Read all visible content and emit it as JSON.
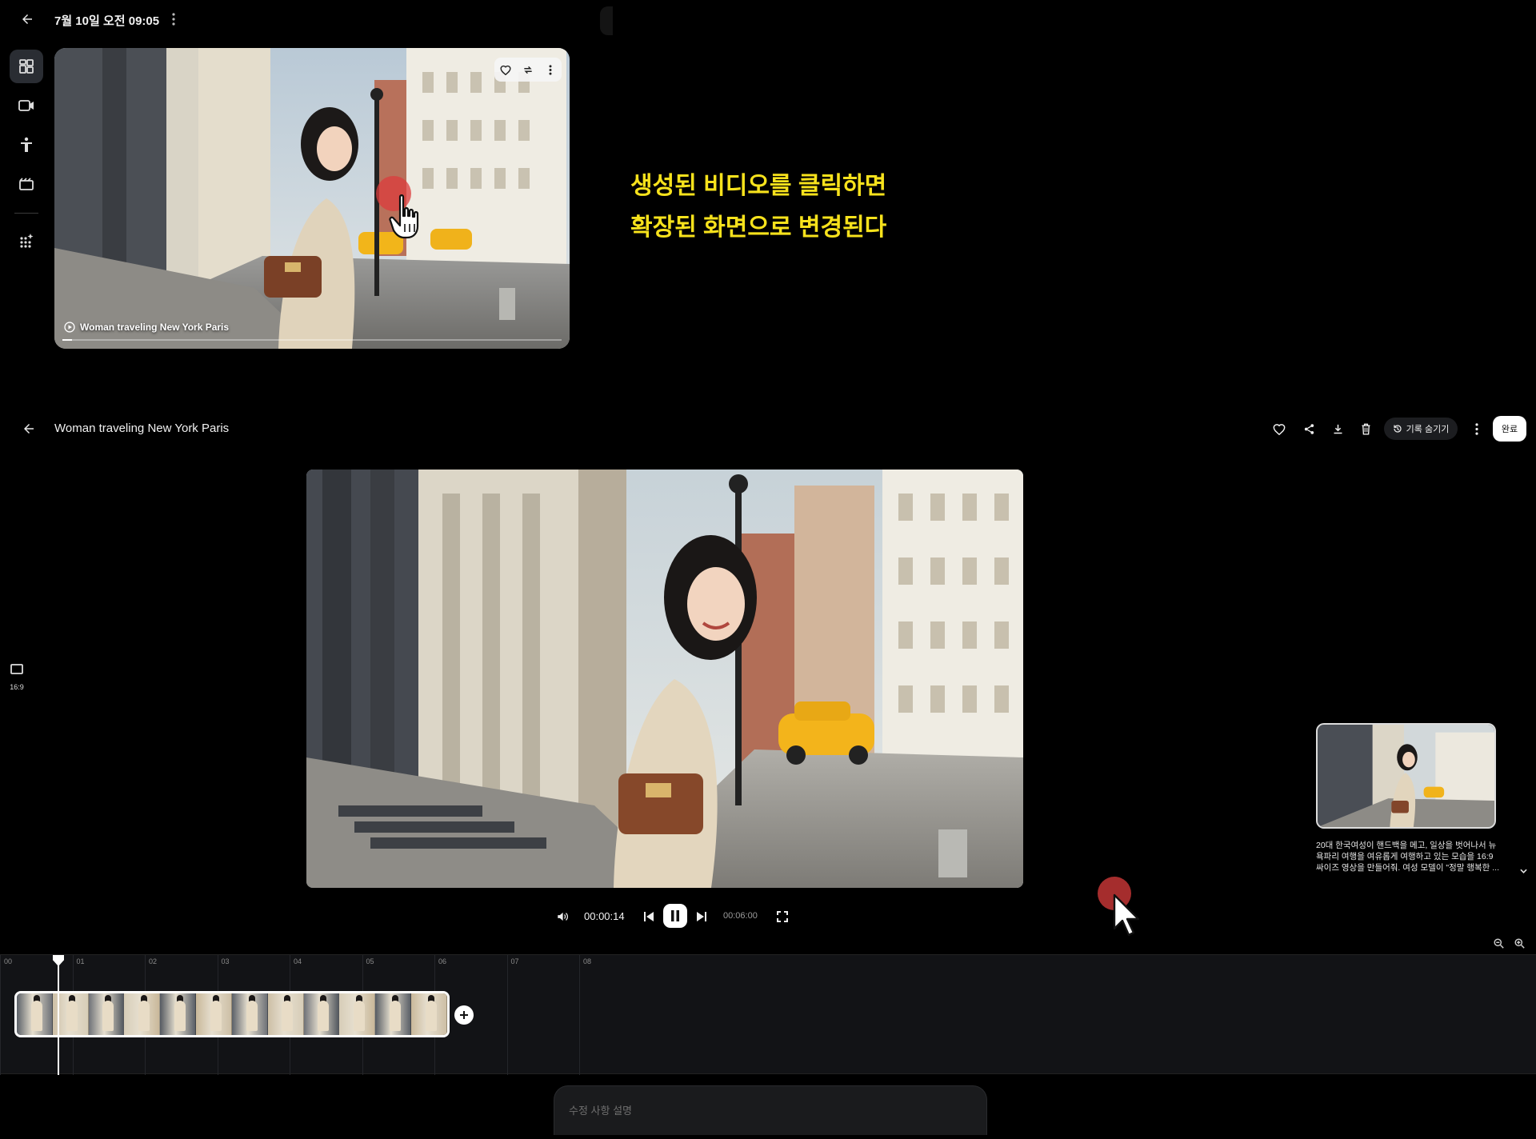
{
  "gallery": {
    "date_label": "7월 10일 오전 09:05",
    "rail_items": [
      "grid-view",
      "video",
      "character",
      "scenes",
      "effects"
    ],
    "thumbnail": {
      "title": "Woman traveling New York Paris",
      "progress": 0.02
    }
  },
  "annotation": {
    "line1": "생성된 비디오를 클릭하면",
    "line2": "확장된 화면으로 변경된다"
  },
  "editor": {
    "title": "Woman traveling New York Paris",
    "history_label": "기록 숨기기",
    "done_label": "완료",
    "aspect_label": "16:9",
    "current_time": "00:00:14",
    "total_time": "00:06:00",
    "prompt_text": "20대 한국여성이 핸드백을 메고, 일상을 벗어나서 뉴욕파리 여행을 여유롭게 여행하고 있는 모습을 16:9 싸이즈 영상을 만들어줘. 여성 모델이 \"정말 행복한 ...",
    "timeline_ticks": [
      "00",
      "01",
      "02",
      "03",
      "04",
      "05",
      "06",
      "07",
      "08"
    ],
    "clip_frame_count": 12,
    "edit_placeholder": "수정 사항 설명"
  },
  "colors": {
    "annotation": "#f7e21c",
    "ripple": "#dc3c3c",
    "timeline_bg": "#121316"
  }
}
